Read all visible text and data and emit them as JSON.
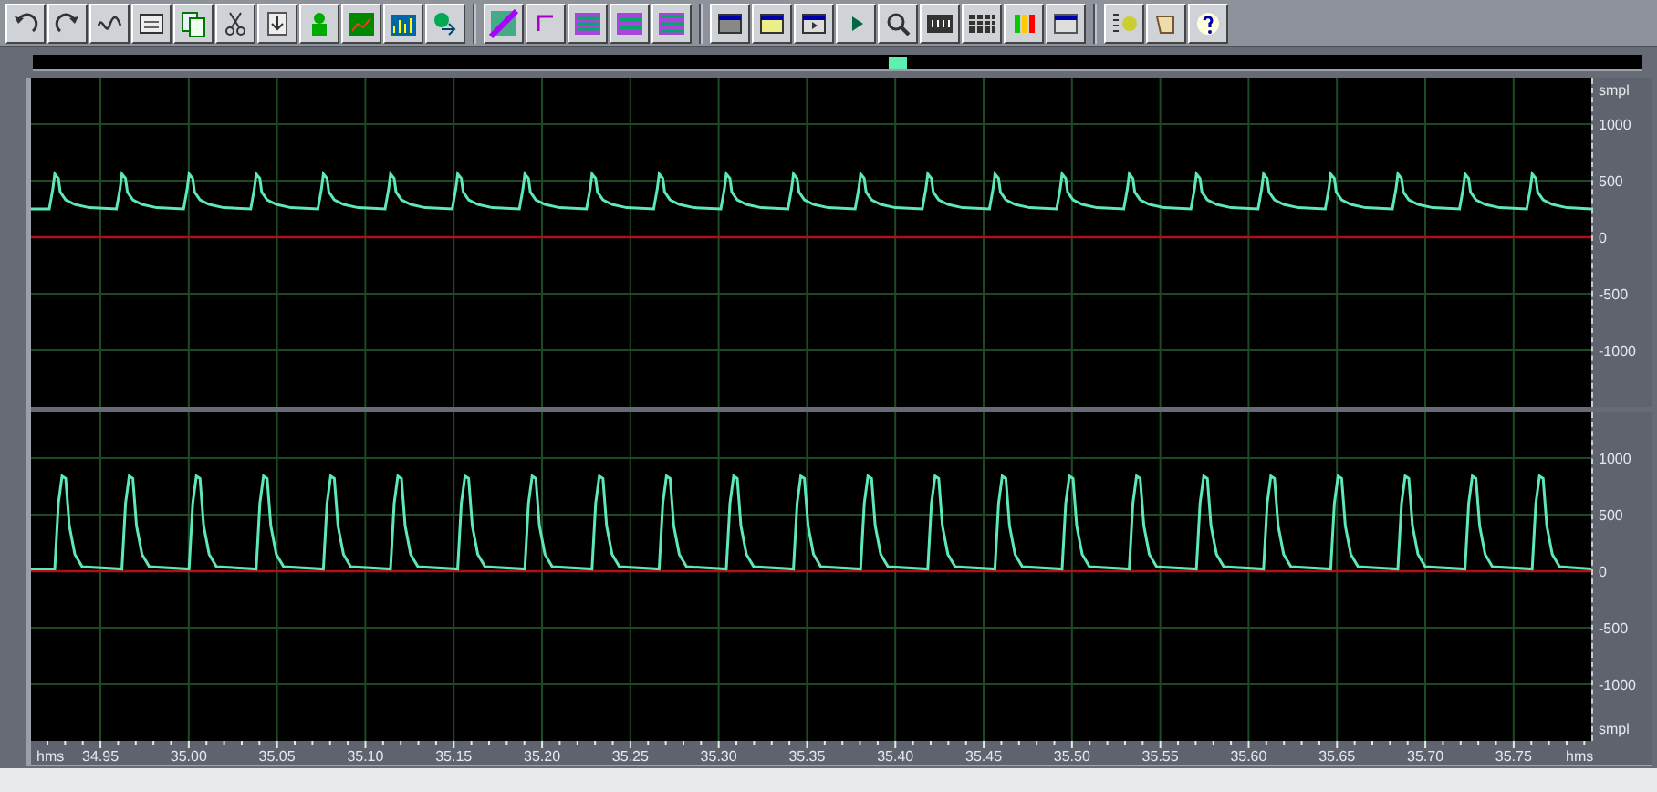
{
  "channels": [
    {
      "scale": [
        {
          "kind": "unit",
          "text": "smpl"
        },
        {
          "kind": "value",
          "text": "1000"
        },
        {
          "kind": "value",
          "text": "500"
        },
        {
          "kind": "value",
          "text": "0"
        },
        {
          "kind": "value",
          "text": "-500"
        },
        {
          "kind": "value",
          "text": "-1000"
        }
      ]
    },
    {
      "scale": [
        {
          "kind": "value",
          "text": "1000"
        },
        {
          "kind": "value",
          "text": "500"
        },
        {
          "kind": "value",
          "text": "0"
        },
        {
          "kind": "value",
          "text": "-500"
        },
        {
          "kind": "value",
          "text": "-1000"
        },
        {
          "kind": "unit",
          "text": "smpl"
        }
      ]
    }
  ],
  "time_ruler": {
    "labels": [
      {
        "kind": "unit",
        "text": "hms"
      },
      {
        "kind": "value",
        "text": "34.95"
      },
      {
        "kind": "value",
        "text": "35.00"
      },
      {
        "kind": "value",
        "text": "35.05"
      },
      {
        "kind": "value",
        "text": "35.10"
      },
      {
        "kind": "value",
        "text": "35.15"
      },
      {
        "kind": "value",
        "text": "35.20"
      },
      {
        "kind": "value",
        "text": "35.25"
      },
      {
        "kind": "value",
        "text": "35.30"
      },
      {
        "kind": "value",
        "text": "35.35"
      },
      {
        "kind": "value",
        "text": "35.40"
      },
      {
        "kind": "value",
        "text": "35.45"
      },
      {
        "kind": "value",
        "text": "35.50"
      },
      {
        "kind": "value",
        "text": "35.55"
      },
      {
        "kind": "value",
        "text": "35.60"
      },
      {
        "kind": "value",
        "text": "35.65"
      },
      {
        "kind": "value",
        "text": "35.70"
      },
      {
        "kind": "value",
        "text": "35.75"
      },
      {
        "kind": "unit",
        "text": "hms"
      }
    ]
  }
}
